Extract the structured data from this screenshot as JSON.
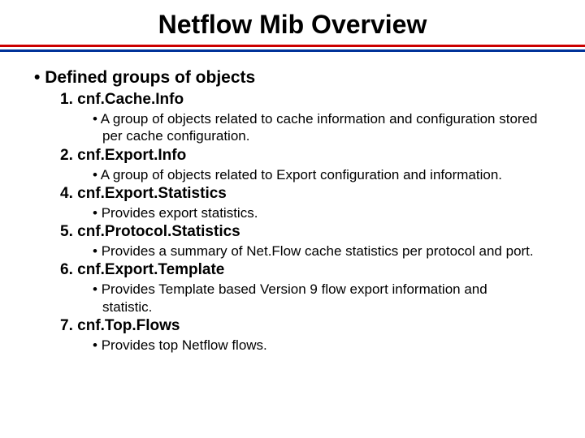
{
  "title": "Netflow Mib Overview",
  "heading": "Defined groups of objects",
  "groups": {
    "g1": {
      "num": "1.",
      "name": "cnf.Cache.Info",
      "desc": " A group of objects related to cache information and configuration stored per cache configuration."
    },
    "g2": {
      "num": "2.",
      "name": "cnf.Export.Info",
      "desc": "A group of objects related to Export configuration and information."
    },
    "g4": {
      "num": "4.",
      "name": "cnf.Export.Statistics",
      "desc": "Provides export statistics."
    },
    "g5": {
      "num": "5.",
      "name": "cnf.Protocol.Statistics",
      "desc": "Provides a summary of Net.Flow cache statistics per protocol and port."
    },
    "g6": {
      "num": "6.",
      "name": "cnf.Export.Template",
      "desc": "Provides Template based Version 9 flow export information and statistic."
    },
    "g7": {
      "num": "7.",
      "name": "cnf.Top.Flows",
      "desc": "Provides top Netflow flows."
    }
  }
}
